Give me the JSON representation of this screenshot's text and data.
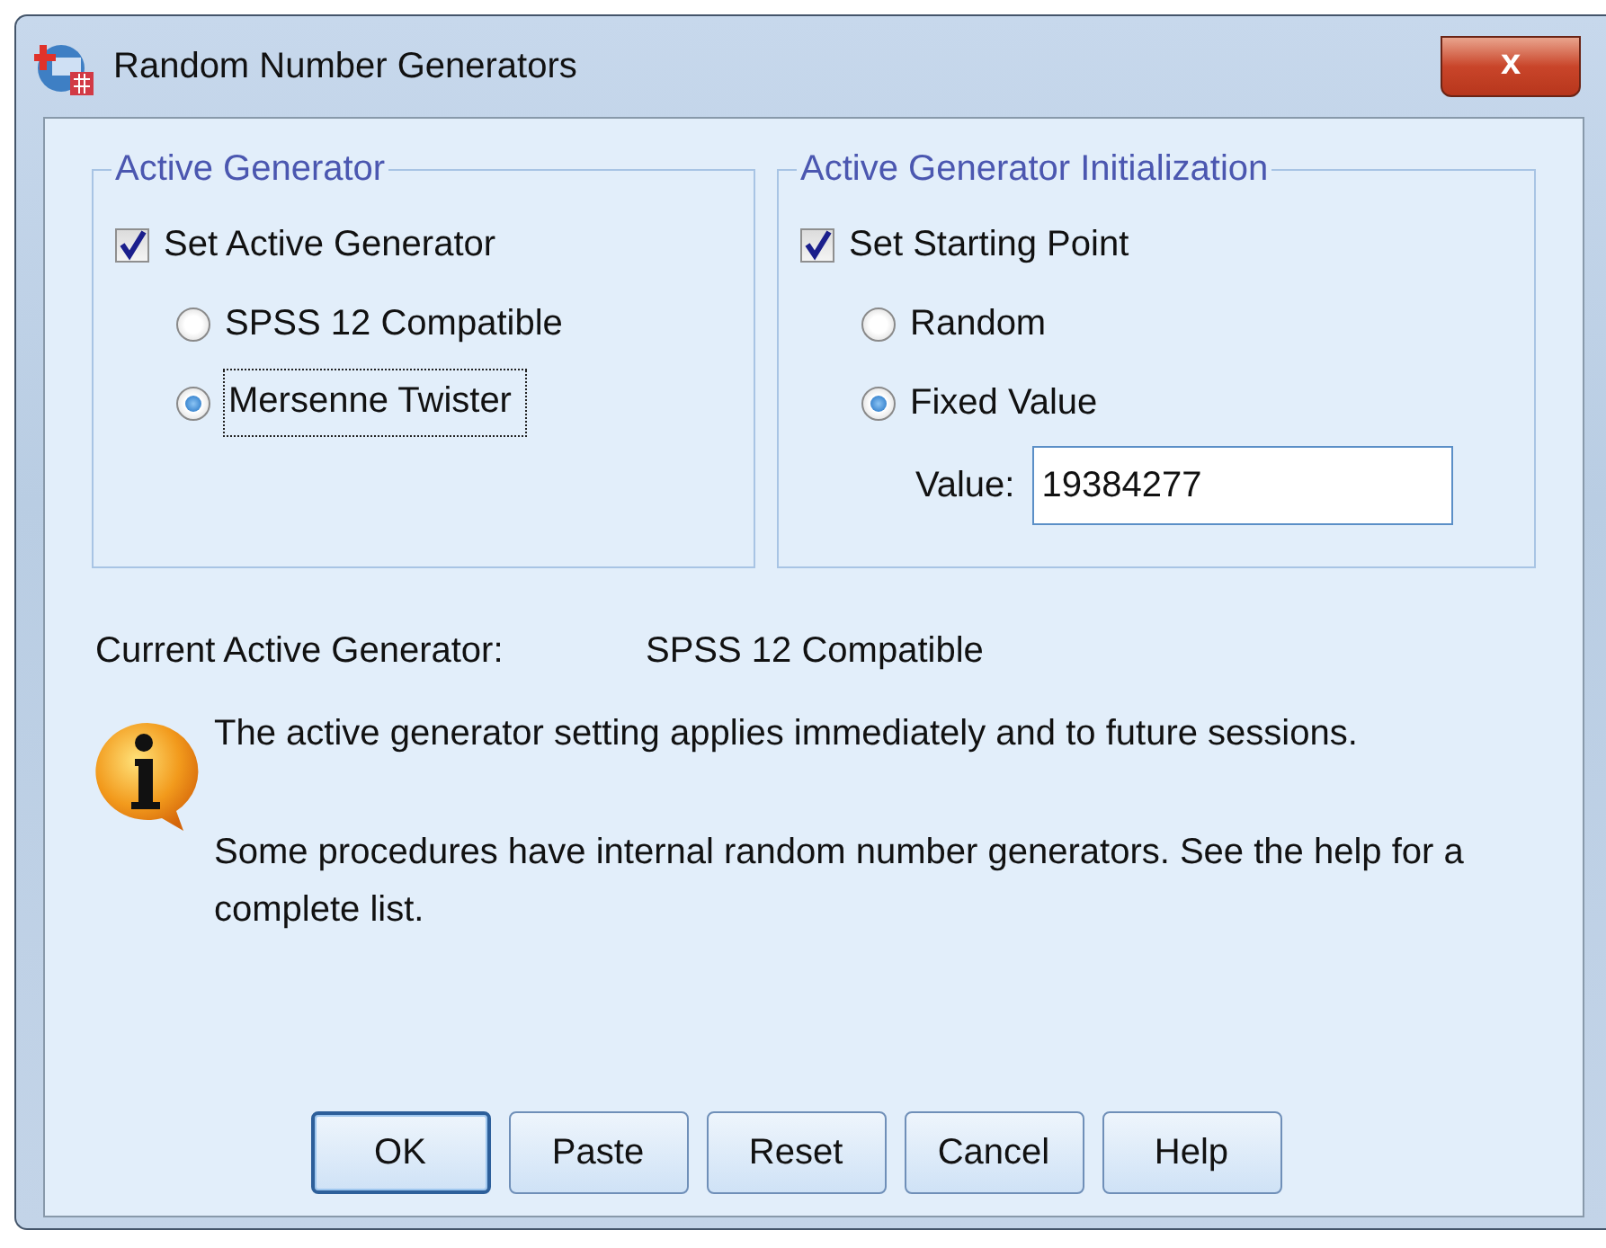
{
  "window": {
    "title": "Random Number Generators",
    "close": "x"
  },
  "groups": [
    {
      "legend": "Active Generator",
      "checkbox": {
        "label": "Set Active Generator",
        "checked": true
      },
      "radios": [
        {
          "label": "SPSS 12 Compatible",
          "selected": false,
          "focused": false
        },
        {
          "label": "Mersenne Twister",
          "selected": true,
          "focused": true
        }
      ]
    },
    {
      "legend": "Active Generator Initialization",
      "checkbox": {
        "label": "Set Starting Point",
        "checked": true
      },
      "radios": [
        {
          "label": "Random",
          "selected": false,
          "focused": false
        },
        {
          "label": "Fixed Value",
          "selected": true,
          "focused": false
        }
      ],
      "field": {
        "label": "Value:",
        "value": "19384277"
      }
    }
  ],
  "current": {
    "label": "Current Active Generator:",
    "value": "SPSS 12 Compatible"
  },
  "info": [
    "The active generator setting applies immediately and to future sessions.",
    "Some procedures have internal random number generators.  See the help for a complete list."
  ],
  "buttons": [
    {
      "label": "OK",
      "default": true
    },
    {
      "label": "Paste",
      "default": false
    },
    {
      "label": "Reset",
      "default": false
    },
    {
      "label": "Cancel",
      "default": false
    },
    {
      "label": "Help",
      "default": false
    }
  ]
}
